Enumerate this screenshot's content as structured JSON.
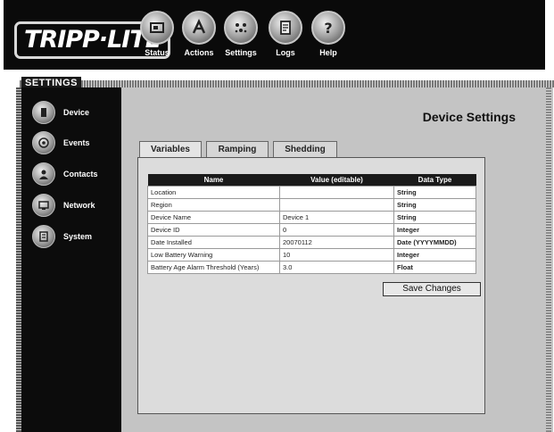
{
  "brand": {
    "logo_text": "TRIPP·LITE"
  },
  "topnav": [
    {
      "label": "Status",
      "icon": "status-icon"
    },
    {
      "label": "Actions",
      "icon": "actions-icon"
    },
    {
      "label": "Settings",
      "icon": "settings-icon"
    },
    {
      "label": "Logs",
      "icon": "logs-icon"
    },
    {
      "label": "Help",
      "icon": "help-icon"
    }
  ],
  "section": {
    "title": "SETTINGS"
  },
  "sidebar": {
    "items": [
      {
        "label": "Device",
        "icon": "device-icon"
      },
      {
        "label": "Events",
        "icon": "events-icon"
      },
      {
        "label": "Contacts",
        "icon": "contacts-icon"
      },
      {
        "label": "Network",
        "icon": "network-icon"
      },
      {
        "label": "System",
        "icon": "system-icon"
      }
    ]
  },
  "page": {
    "title": "Device Settings"
  },
  "tabs": [
    {
      "label": "Variables",
      "active": true
    },
    {
      "label": "Ramping",
      "active": false
    },
    {
      "label": "Shedding",
      "active": false
    }
  ],
  "table": {
    "headers": [
      "Name",
      "Value (editable)",
      "Data Type"
    ],
    "rows": [
      {
        "name": "Location",
        "value": "",
        "type": "String"
      },
      {
        "name": "Region",
        "value": "",
        "type": "String"
      },
      {
        "name": "Device Name",
        "value": "Device 1",
        "type": "String"
      },
      {
        "name": "Device ID",
        "value": "0",
        "type": "Integer"
      },
      {
        "name": "Date Installed",
        "value": "20070112",
        "type": "Date (YYYYMMDD)"
      },
      {
        "name": "Low Battery Warning",
        "value": "10",
        "type": "Integer"
      },
      {
        "name": "Battery Age Alarm Threshold (Years)",
        "value": "3.0",
        "type": "Float"
      }
    ]
  },
  "actions": {
    "save_label": "Save Changes"
  },
  "colors": {
    "top_bar": "#0a0a0a",
    "sidebar": "#0c0c0c",
    "content_bg": "#c4c4c4",
    "table_header": "#1a1a1a"
  }
}
